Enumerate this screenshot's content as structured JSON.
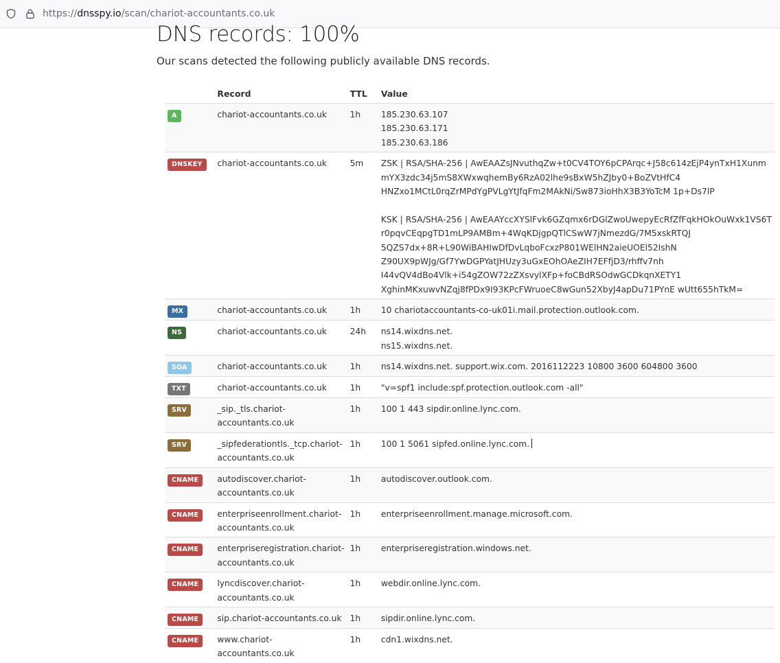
{
  "browser": {
    "url_prefix": "https://",
    "url_host": "dnsspy.io",
    "url_path": "/scan/chariot-accountants.co.uk"
  },
  "page": {
    "title": "DNS records: 100%",
    "intro": "Our scans detected the following publicly available DNS records."
  },
  "table": {
    "headers": [
      "",
      "Record",
      "TTL",
      "Value"
    ],
    "rows": [
      {
        "type": "A",
        "color": "#5cb85c",
        "record": "chariot-accountants.co.uk",
        "ttl": "1h",
        "value": [
          "185.230.63.107",
          "185.230.63.171",
          "185.230.63.186"
        ]
      },
      {
        "type": "DNSKEY",
        "color": "#b94a48",
        "record": "chariot-accountants.co.uk",
        "ttl": "5m",
        "value": [
          "ZSK | RSA/SHA-256 | AwEAAZsJNvuthqZw+t0CV4TOY6pCPArqc+J58c614zEjP4ynTxH1Xunm",
          "mYX3zdc34j5mS8XWxwqhemBy6RzA02lhe9sBxW5hZJby0+BoZVtHfC4",
          "HNZxo1MCtL0rqZrMPdYgPVLgYtJfqFm2MAkNi/Sw873ioHhX3B3YoTcM 1p+Ds7lP",
          "",
          "KSK | RSA/SHA-256 | AwEAAYccXYSlFvk6GZqmx6rDGlZwoUwepyEcRfZfFqkHOkOuWxk1VS6T",
          "r0pqvCEqpgTD1mLP9AMBm+4WqKDjgpQTlCSwW7jNmezdG/7M5xskRTQJ",
          "5QZS7dx+8R+L90WiBAHIwDfDvLqboFcxzP801WElHN2aieUOEl52IshN",
          "Z90UX9pWJg/Gf7YwDGPYatJHUzy3uGxEOhOAeZIH7EFfjD3/rhffv7nh",
          "I44vQV4dBo4Vlk+i54gZOW72zZXsvylXFp+foCBdRSOdwGCDkqnXETY1",
          "XghinMKxuwvNZqj8fPDx9I93KPcFWruoeC8wGun52XbyJ4apDu71PYnE wUtt655hTkM="
        ]
      },
      {
        "type": "MX",
        "color": "#3a6ea5",
        "record": "chariot-accountants.co.uk",
        "ttl": "1h",
        "value": [
          "10 chariotaccountants-co-uk01i.mail.protection.outlook.com."
        ]
      },
      {
        "type": "NS",
        "color": "#3d6b3d",
        "record": "chariot-accountants.co.uk",
        "ttl": "24h",
        "value": [
          "ns14.wixdns.net.",
          "ns15.wixdns.net."
        ]
      },
      {
        "type": "SOA",
        "color": "#8fc7e6",
        "record": "chariot-accountants.co.uk",
        "ttl": "1h",
        "value": [
          "ns14.wixdns.net. support.wix.com. 2016112223 10800 3600 604800 3600"
        ]
      },
      {
        "type": "TXT",
        "color": "#777777",
        "record": "chariot-accountants.co.uk",
        "ttl": "1h",
        "value": [
          "\"v=spf1 include:spf.protection.outlook.com -all\""
        ]
      },
      {
        "type": "SRV",
        "color": "#8a6d3b",
        "record": "_sip._tls.chariot-accountants.co.uk",
        "ttl": "1h",
        "value": [
          "100 1 443 sipdir.online.lync.com."
        ]
      },
      {
        "type": "SRV",
        "color": "#8a6d3b",
        "record": "_sipfederationtls._tcp.chariot-accountants.co.uk",
        "ttl": "1h",
        "value": [
          "100 1 5061 sipfed.online.lync.com."
        ]
      },
      {
        "type": "CNAME",
        "color": "#b94a48",
        "record": "autodiscover.chariot-accountants.co.uk",
        "ttl": "1h",
        "value": [
          "autodiscover.outlook.com."
        ]
      },
      {
        "type": "CNAME",
        "color": "#b94a48",
        "record": "enterpriseenrollment.chariot-accountants.co.uk",
        "ttl": "1h",
        "value": [
          "enterpriseenrollment.manage.microsoft.com."
        ]
      },
      {
        "type": "CNAME",
        "color": "#b94a48",
        "record": "enterpriseregistration.chariot-accountants.co.uk",
        "ttl": "1h",
        "value": [
          "enterpriseregistration.windows.net."
        ]
      },
      {
        "type": "CNAME",
        "color": "#b94a48",
        "record": "lyncdiscover.chariot-accountants.co.uk",
        "ttl": "1h",
        "value": [
          "webdir.online.lync.com."
        ]
      },
      {
        "type": "CNAME",
        "color": "#b94a48",
        "record": "sip.chariot-accountants.co.uk",
        "ttl": "1h",
        "value": [
          "sipdir.online.lync.com."
        ]
      },
      {
        "type": "CNAME",
        "color": "#b94a48",
        "record": "www.chariot-accountants.co.uk",
        "ttl": "1h",
        "value": [
          "cdn1.wixdns.net."
        ]
      }
    ]
  }
}
